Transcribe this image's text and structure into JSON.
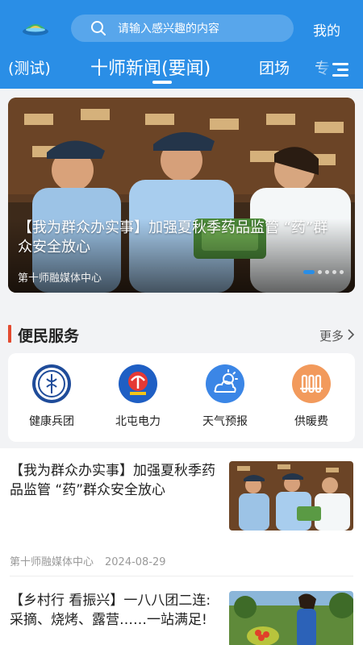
{
  "header": {
    "search_placeholder": "请输入感兴趣的内容",
    "mine_label": "我的",
    "accent": "#2a8ee6"
  },
  "tabs": [
    {
      "label": "(测试)",
      "active": false
    },
    {
      "label": "十师新闻(要闻)",
      "active": true
    },
    {
      "label": "团场",
      "active": false
    },
    {
      "label": "专",
      "active": false
    }
  ],
  "banner": {
    "title": "【我为群众办实事】加强夏秋季药品监管 “药”群众安全放心",
    "source": "第十师融媒体中心",
    "slides": 5,
    "current_slide": 1
  },
  "services": {
    "title": "便民服务",
    "more_label": "更多",
    "items": [
      {
        "label": "健康兵团",
        "icon": "health-bingtuan-icon"
      },
      {
        "label": "北屯电力",
        "icon": "beitun-power-icon"
      },
      {
        "label": "天气预报",
        "icon": "weather-icon"
      },
      {
        "label": "供暖费",
        "icon": "heating-icon"
      }
    ]
  },
  "news": [
    {
      "title": "【我为群众办实事】加强夏秋季药品监管 “药”群众安全放心",
      "source": "第十师融媒体中心",
      "date": "2024-08-29"
    },
    {
      "title": "【乡村行 看振兴】一八八团二连:采摘、烧烤、露营……一站满足!",
      "source": "",
      "date": ""
    }
  ]
}
